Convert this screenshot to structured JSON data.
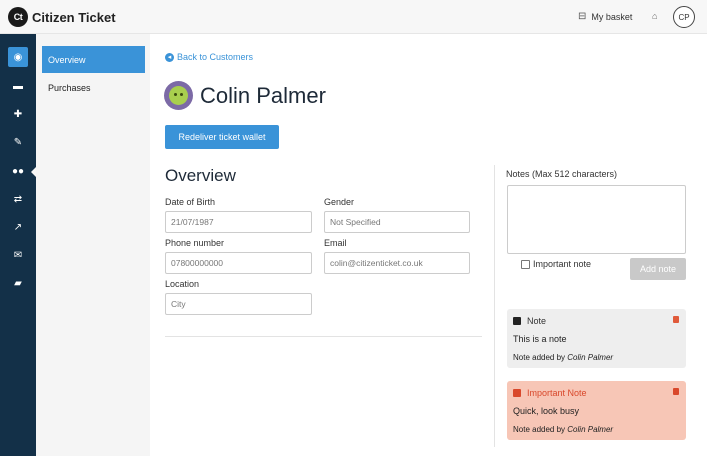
{
  "app": {
    "logo_mark": "Ct",
    "name": "Citizen Ticket"
  },
  "header": {
    "basket_icon": "basket-icon",
    "basket_label": "My basket",
    "gift_icon": "gift-icon",
    "user_initials": "CP"
  },
  "rail": {
    "items": [
      {
        "icon": "dashboard-icon",
        "glyph": "◉",
        "active": true
      },
      {
        "icon": "ticket-icon",
        "glyph": "▬",
        "active": false
      },
      {
        "icon": "plus-icon",
        "glyph": "✚",
        "active": false
      },
      {
        "icon": "magic-wand-icon",
        "glyph": "✎",
        "active": false
      },
      {
        "icon": "customers-icon",
        "glyph": "👥",
        "active": false
      },
      {
        "icon": "transfer-icon",
        "glyph": "⇄",
        "active": false
      },
      {
        "icon": "chart-icon",
        "glyph": "↗",
        "active": false
      },
      {
        "icon": "mail-icon",
        "glyph": "✉",
        "active": false
      },
      {
        "icon": "truck-icon",
        "glyph": "▰",
        "active": false
      }
    ]
  },
  "subnav": {
    "overview": "Overview",
    "purchases": "Purchases"
  },
  "back_link": "Back to Customers",
  "customer": {
    "name": "Colin Palmer",
    "redeliver_label": "Redeliver ticket wallet"
  },
  "overview": {
    "title": "Overview",
    "dob_label": "Date of Birth",
    "dob_value": "21/07/1987",
    "gender_label": "Gender",
    "gender_value": "Not Specified",
    "phone_label": "Phone number",
    "phone_value": "07800000000",
    "email_label": "Email",
    "email_value": "colin@citizenticket.co.uk",
    "location_label": "Location",
    "location_placeholder": "City"
  },
  "notes": {
    "label": "Notes (Max 512 characters)",
    "important_label": "Important note",
    "add_label": "Add note",
    "items": [
      {
        "type": "Note",
        "body": "This is a note",
        "meta_prefix": "Note added by",
        "author": "Colin Palmer"
      },
      {
        "type": "Important Note",
        "body": "Quick, look busy",
        "meta_prefix": "Note added by",
        "author": "Colin Palmer"
      }
    ]
  },
  "colors": {
    "accent": "#3a93d8",
    "rail": "#133048",
    "important_bg": "#f7c6b6",
    "important_text": "#d9482b"
  }
}
